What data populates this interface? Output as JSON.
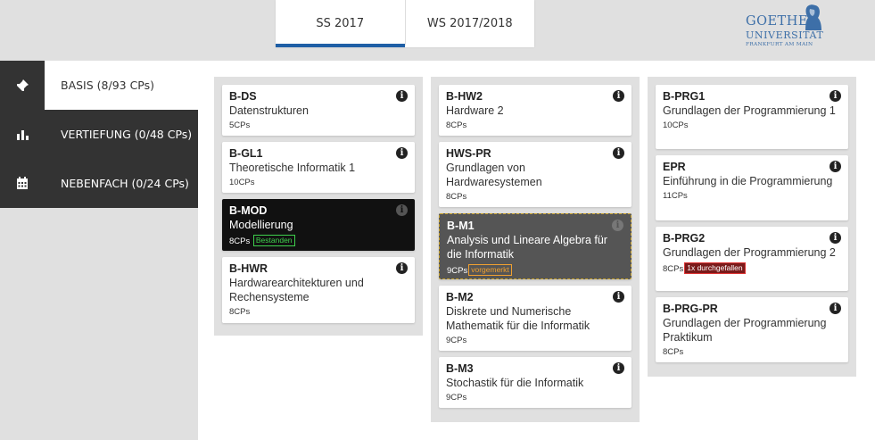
{
  "semesters": [
    {
      "label": "SS 2017",
      "active": true
    },
    {
      "label": "WS 2017/2018",
      "active": false
    }
  ],
  "logo": {
    "line1": "GOETHE",
    "line2": "UNIVERSITÄT",
    "line3": "FRANKFURT AM MAIN"
  },
  "sidebar": {
    "items": [
      {
        "label": "BASIS (8/93 CPs)",
        "icon": "pin-icon",
        "active": true
      },
      {
        "label": "VERTIEFUNG (0/48 CPs)",
        "icon": "bar-chart-icon",
        "active": false
      },
      {
        "label": "NEBENFACH (0/24 CPs)",
        "icon": "calendar-icon",
        "active": false
      }
    ]
  },
  "columns": [
    [
      {
        "code": "B-DS",
        "title": "Datenstrukturen",
        "cp": "5CPs"
      },
      {
        "code": "B-GL1",
        "title": "Theoretische Informatik 1",
        "cp": "10CPs"
      },
      {
        "code": "B-MOD",
        "title": "Modellierung",
        "cp": "8CPs",
        "badge": "Bestanden",
        "style": "dark"
      },
      {
        "code": "B-HWR",
        "title": "Hardwarearchitekturen und Rechensysteme",
        "cp": "8CPs"
      }
    ],
    [
      {
        "code": "B-HW2",
        "title": "Hardware 2",
        "cp": "8CPs"
      },
      {
        "code": "HWS-PR",
        "title": "Grundlagen von Hardwaresystemen",
        "cp": "8CPs"
      },
      {
        "code": "B-M1",
        "title": "Analysis und Lineare Algebra für die Informatik",
        "cp": "9CPs",
        "badge": "vorgemerkt",
        "style": "grey"
      },
      {
        "code": "B-M2",
        "title": "Diskrete und Numerische Mathematik für die Informatik",
        "cp": "9CPs"
      },
      {
        "code": "B-M3",
        "title": "Stochastik für die Informatik",
        "cp": "9CPs"
      }
    ],
    [
      {
        "code": "B-PRG1",
        "title": "Grundlagen der Programmierung 1",
        "cp": "10CPs"
      },
      {
        "code": "EPR",
        "title": "Einführung in die Programmierung",
        "cp": "11CPs"
      },
      {
        "code": "B-PRG2",
        "title": "Grundlagen der Programmierung 2",
        "cp": "8CPs",
        "badge": "1x durchgefallen",
        "style": "failed"
      },
      {
        "code": "B-PRG-PR",
        "title": "Grundlagen der Programmierung Praktikum",
        "cp": "8CPs"
      }
    ]
  ],
  "info_glyph": "i",
  "colors": {
    "accent": "#1f5fa6",
    "passed": "#3ecf4c",
    "planned": "#f0a030",
    "failed": "#7a1a1a"
  }
}
